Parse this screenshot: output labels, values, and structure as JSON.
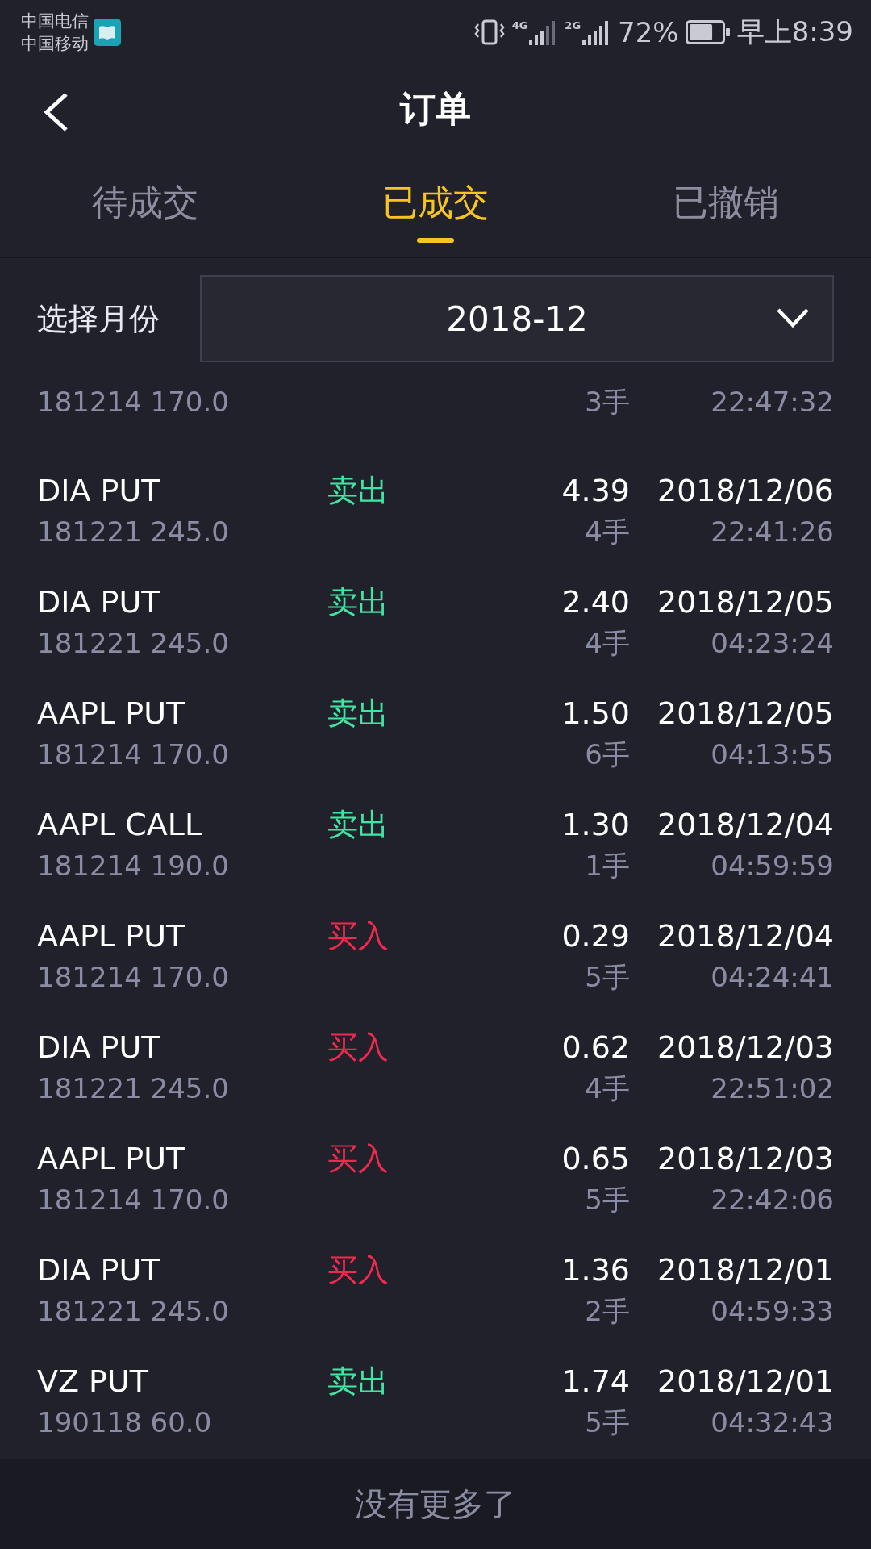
{
  "status_bar": {
    "carriers": [
      "中国电信",
      "中国移动"
    ],
    "networks": [
      "4G",
      "2G"
    ],
    "battery": "72%",
    "time": "早上8:39"
  },
  "header": {
    "title": "订单"
  },
  "tabs": [
    {
      "label": "待成交",
      "selected": false
    },
    {
      "label": "已成交",
      "selected": true
    },
    {
      "label": "已撤销",
      "selected": false
    }
  ],
  "month_filter": {
    "label": "选择月份",
    "value": "2018-12"
  },
  "orders": [
    {
      "contract": "181214 170.0",
      "qty": "3手",
      "time": "22:47:32"
    },
    {
      "symbol": "DIA PUT",
      "contract": "181221 245.0",
      "side": "卖出",
      "kind": "sell",
      "price": "4.39",
      "qty": "4手",
      "date": "2018/12/06",
      "time": "22:41:26"
    },
    {
      "symbol": "DIA PUT",
      "contract": "181221 245.0",
      "side": "卖出",
      "kind": "sell",
      "price": "2.40",
      "qty": "4手",
      "date": "2018/12/05",
      "time": "04:23:24"
    },
    {
      "symbol": "AAPL PUT",
      "contract": "181214 170.0",
      "side": "卖出",
      "kind": "sell",
      "price": "1.50",
      "qty": "6手",
      "date": "2018/12/05",
      "time": "04:13:55"
    },
    {
      "symbol": "AAPL CALL",
      "contract": "181214 190.0",
      "side": "卖出",
      "kind": "sell",
      "price": "1.30",
      "qty": "1手",
      "date": "2018/12/04",
      "time": "04:59:59"
    },
    {
      "symbol": "AAPL PUT",
      "contract": "181214 170.0",
      "side": "买入",
      "kind": "buy",
      "price": "0.29",
      "qty": "5手",
      "date": "2018/12/04",
      "time": "04:24:41"
    },
    {
      "symbol": "DIA PUT",
      "contract": "181221 245.0",
      "side": "买入",
      "kind": "buy",
      "price": "0.62",
      "qty": "4手",
      "date": "2018/12/03",
      "time": "22:51:02"
    },
    {
      "symbol": "AAPL PUT",
      "contract": "181214 170.0",
      "side": "买入",
      "kind": "buy",
      "price": "0.65",
      "qty": "5手",
      "date": "2018/12/03",
      "time": "22:42:06"
    },
    {
      "symbol": "DIA PUT",
      "contract": "181221 245.0",
      "side": "买入",
      "kind": "buy",
      "price": "1.36",
      "qty": "2手",
      "date": "2018/12/01",
      "time": "04:59:33"
    },
    {
      "symbol": "VZ PUT",
      "contract": "190118 60.0",
      "side": "卖出",
      "kind": "sell",
      "price": "1.74",
      "qty": "5手",
      "date": "2018/12/01",
      "time": "04:32:43"
    }
  ],
  "footer": {
    "text": "没有更多了"
  }
}
